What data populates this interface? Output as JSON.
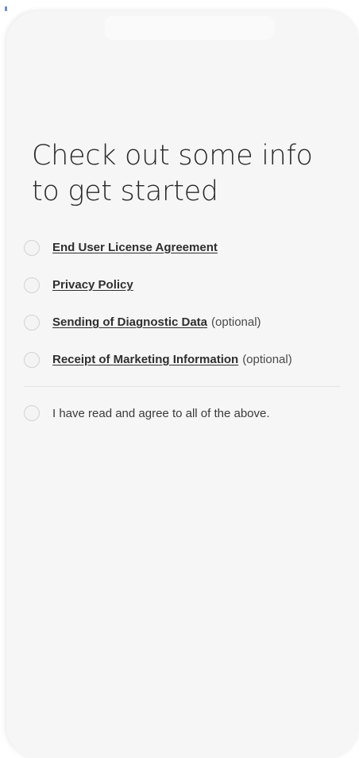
{
  "page": {
    "heading_line1": "Check out some info",
    "heading_line2": "to get started"
  },
  "consents": [
    {
      "label": "End User License Agreement",
      "suffix": ""
    },
    {
      "label": "Privacy Policy",
      "suffix": ""
    },
    {
      "label": "Sending of Diagnostic Data",
      "suffix": "(optional)"
    },
    {
      "label": "Receipt of Marketing Information",
      "suffix": "(optional)"
    }
  ],
  "agree_all": {
    "label": "I have read and agree to all of the above."
  },
  "colors": {
    "background": "#f6f6f7",
    "text": "#2a2a2a",
    "radio_border": "#d3d3d6",
    "divider": "#e3e3e5"
  }
}
